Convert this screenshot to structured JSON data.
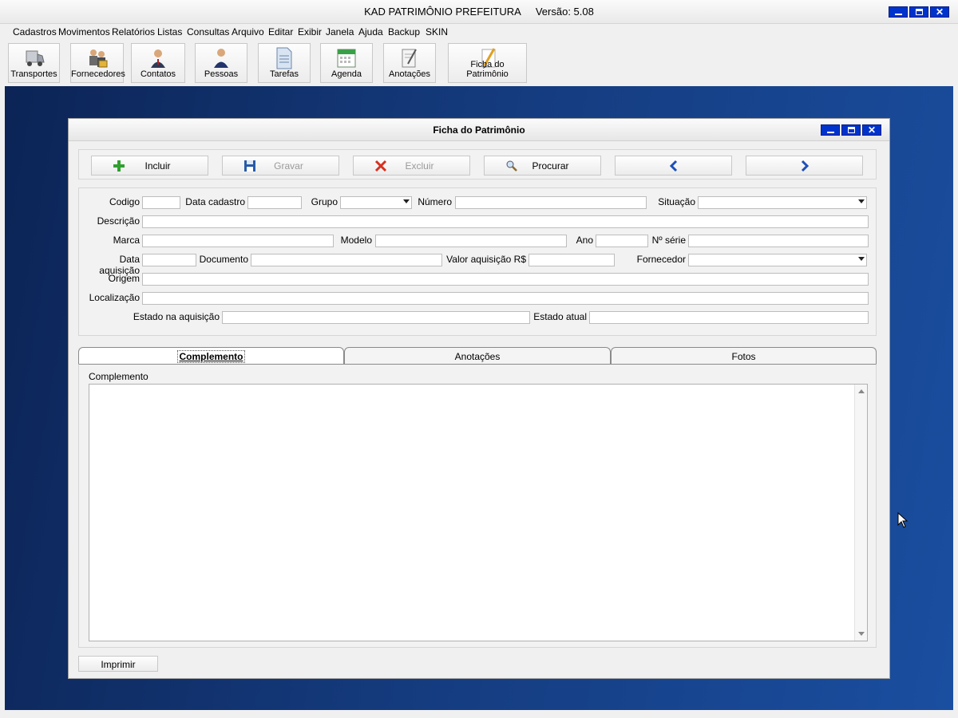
{
  "app": {
    "title": "KAD PATRIMÔNIO PREFEITURA",
    "version": "Versão: 5.08"
  },
  "menu": [
    "Cadastros",
    "Movimentos",
    "Relatórios",
    "Listas",
    "Consultas",
    "Arquivo",
    "Editar",
    "Exibir",
    "Janela",
    "Ajuda",
    "Backup",
    "SKIN"
  ],
  "toolbar": [
    {
      "label": "Transportes",
      "icon": "truck-icon"
    },
    {
      "label": "Fornecedores",
      "icon": "suppliers-icon"
    },
    {
      "label": "Contatos",
      "icon": "contact-person-icon"
    },
    {
      "label": "Pessoas",
      "icon": "person-icon"
    },
    {
      "label": "Tarefas",
      "icon": "document-icon"
    },
    {
      "label": "Agenda",
      "icon": "calendar-icon"
    },
    {
      "label": "Anotações",
      "icon": "notepad-icon"
    },
    {
      "label": "Ficha do Patrimônio",
      "icon": "pencil-icon"
    }
  ],
  "window": {
    "title": "Ficha do Patrimônio",
    "actions": [
      {
        "label": "Incluir",
        "icon": "plus-icon",
        "enabled": true
      },
      {
        "label": "Gravar",
        "icon": "floppy-disk-icon",
        "enabled": false
      },
      {
        "label": "Excluir",
        "icon": "x-delete-icon",
        "enabled": false
      },
      {
        "label": "Procurar",
        "icon": "magnifier-icon",
        "enabled": true
      },
      {
        "label": "",
        "icon": "chevron-left-icon",
        "enabled": true
      },
      {
        "label": "",
        "icon": "chevron-right-icon",
        "enabled": true
      }
    ],
    "fields": {
      "codigo": {
        "label": "Codigo",
        "value": ""
      },
      "data_cadastro": {
        "label": "Data cadastro",
        "value": ""
      },
      "grupo": {
        "label": "Grupo",
        "value": ""
      },
      "numero": {
        "label": "Número",
        "value": ""
      },
      "situacao": {
        "label": "Situação",
        "value": ""
      },
      "descricao": {
        "label": "Descrição",
        "value": ""
      },
      "marca": {
        "label": "Marca",
        "value": ""
      },
      "modelo": {
        "label": "Modelo",
        "value": ""
      },
      "ano": {
        "label": "Ano",
        "value": ""
      },
      "n_serie": {
        "label": "Nº série",
        "value": ""
      },
      "data_aquisicao": {
        "label": "Data aquisição",
        "value": ""
      },
      "documento": {
        "label": "Documento",
        "value": ""
      },
      "valor_aquisicao": {
        "label": "Valor aquisição R$",
        "value": ""
      },
      "fornecedor": {
        "label": "Fornecedor",
        "value": ""
      },
      "origem": {
        "label": "Origem",
        "value": ""
      },
      "localizacao": {
        "label": "Localização",
        "value": ""
      },
      "estado_aquisicao": {
        "label": "Estado na aquisição",
        "value": ""
      },
      "estado_atual": {
        "label": "Estado atual",
        "value": ""
      }
    },
    "tabs": [
      {
        "label": "Complemento",
        "active": true
      },
      {
        "label": "Anotações",
        "active": false
      },
      {
        "label": "Fotos",
        "active": false
      }
    ],
    "memo_label": "Complemento",
    "memo_value": "",
    "print_label": "Imprimir"
  }
}
